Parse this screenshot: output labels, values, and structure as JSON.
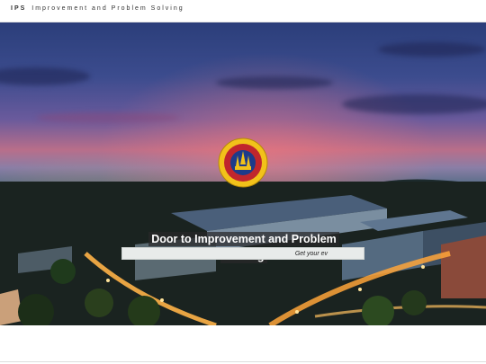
{
  "header": {
    "brand_abbr": "IPS",
    "brand_name": "Improvement and Problem Solving"
  },
  "hero": {
    "headline": "Door to Improvement and Problem Solving",
    "cta_label": "Get your ev",
    "logo_text": "UNIVERSITI KUALA LUMPUR"
  },
  "colors": {
    "cta_background": "#e8ebea",
    "headline_background": "#282828",
    "logo_gold": "#f2c21a",
    "logo_red": "#c0262d",
    "logo_blue": "#1d3b8a"
  }
}
